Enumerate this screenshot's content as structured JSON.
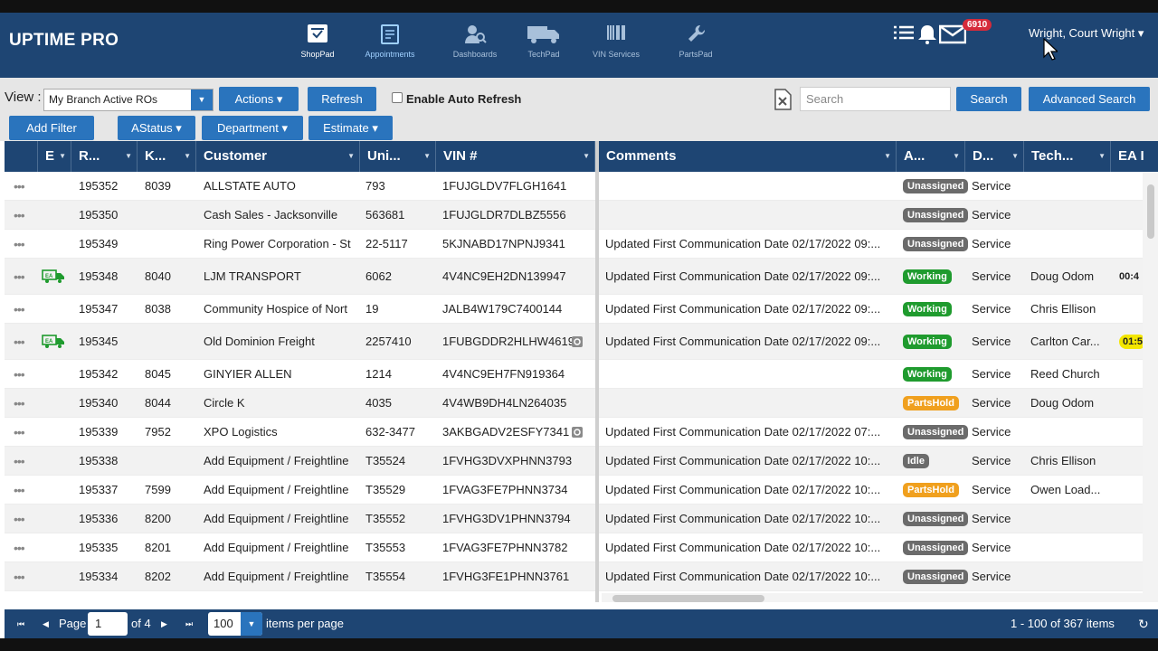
{
  "app": {
    "title": "UPTIME PRO"
  },
  "nav": [
    {
      "label": "ShopPad",
      "icon": "shoppad-icon"
    },
    {
      "label": "Appointments",
      "icon": "appointments-icon"
    },
    {
      "label": "Dashboards",
      "icon": "dashboards-icon"
    },
    {
      "label": "TechPad",
      "icon": "techpad-truck-icon"
    },
    {
      "label": "VIN Services",
      "icon": "barcode-icon"
    },
    {
      "label": "PartsPad",
      "icon": "wrench-icon"
    }
  ],
  "header": {
    "mail_badge": "6910",
    "user": "Wright, Court Wright ▾"
  },
  "toolbar": {
    "view_label": "View :",
    "view_value": "My Branch Active ROs",
    "actions_label": "Actions ▾",
    "refresh_label": "Refresh",
    "auto_refresh_label": "Enable Auto Refresh",
    "search_placeholder": "Search",
    "search_label": "Search",
    "advanced_search_label": "Advanced Search"
  },
  "filters": {
    "add_filter": "Add Filter",
    "astatus": "AStatus ▾",
    "department": "Department ▾",
    "estimate": "Estimate ▾"
  },
  "columns": [
    "E",
    "R...",
    "K...",
    "Customer",
    "Uni...",
    "VIN #",
    "Comments",
    "A...",
    "D...",
    "Tech...",
    "EA I"
  ],
  "status_colors": {
    "Unassigned": "#6b6b6b",
    "Working": "#1f9b2e",
    "PartsHold": "#f0a01e",
    "Idle": "#6b6b6b"
  },
  "rows": [
    {
      "ro": "195352",
      "k": "8039",
      "customer": "ALLSTATE AUTO",
      "unit": "793",
      "vin": "1FUJGLDV7FLGH1641",
      "comments": "",
      "status": "Unassigned",
      "dept": "Service",
      "tech": "",
      "ea": "",
      "icon": false,
      "vinicon": false,
      "ea_style": ""
    },
    {
      "ro": "195350",
      "k": "",
      "customer": "Cash Sales - Jacksonville",
      "unit": "563681",
      "vin": "1FUJGLDR7DLBZ5556",
      "comments": "",
      "status": "Unassigned",
      "dept": "Service",
      "tech": "",
      "ea": "",
      "icon": false,
      "vinicon": false,
      "ea_style": ""
    },
    {
      "ro": "195349",
      "k": "",
      "customer": "Ring Power Corporation - St",
      "unit": "22-5117",
      "vin": "5KJNABD17NPNJ9341",
      "comments": "Updated First Communication Date 02/17/2022 09:...",
      "status": "Unassigned",
      "dept": "Service",
      "tech": "",
      "ea": "",
      "icon": false,
      "vinicon": false,
      "ea_style": ""
    },
    {
      "ro": "195348",
      "k": "8040",
      "customer": "LJM TRANSPORT",
      "unit": "6062",
      "vin": "4V4NC9EH2DN139947",
      "comments": "Updated First Communication Date 02/17/2022 09:...",
      "status": "Working",
      "dept": "Service",
      "tech": "Doug Odom",
      "ea": "00:4",
      "icon": true,
      "vinicon": false,
      "ea_style": "plain"
    },
    {
      "ro": "195347",
      "k": "8038",
      "customer": "Community Hospice of Nort",
      "unit": "19",
      "vin": "JALB4W179C7400144",
      "comments": "Updated First Communication Date 02/17/2022 09:...",
      "status": "Working",
      "dept": "Service",
      "tech": "Chris Ellison",
      "ea": "",
      "icon": false,
      "vinicon": false,
      "ea_style": ""
    },
    {
      "ro": "195345",
      "k": "",
      "customer": "Old Dominion Freight",
      "unit": "2257410",
      "vin": "1FUBGDDR2HLHW4619",
      "comments": "Updated First Communication Date 02/17/2022 09:...",
      "status": "Working",
      "dept": "Service",
      "tech": "Carlton Car...",
      "ea": "01:5",
      "icon": true,
      "vinicon": true,
      "ea_style": "yellow"
    },
    {
      "ro": "195342",
      "k": "8045",
      "customer": "GINYIER ALLEN",
      "unit": "1214",
      "vin": "4V4NC9EH7FN919364",
      "comments": "",
      "status": "Working",
      "dept": "Service",
      "tech": "Reed Church",
      "ea": "",
      "icon": false,
      "vinicon": false,
      "ea_style": ""
    },
    {
      "ro": "195340",
      "k": "8044",
      "customer": "Circle K",
      "unit": "4035",
      "vin": "4V4WB9DH4LN264035",
      "comments": "",
      "status": "PartsHold",
      "dept": "Service",
      "tech": "Doug Odom",
      "ea": "",
      "icon": false,
      "vinicon": false,
      "ea_style": ""
    },
    {
      "ro": "195339",
      "k": "7952",
      "customer": "XPO Logistics",
      "unit": "632-3477",
      "vin": "3AKBGADV2ESFY7341",
      "comments": "Updated First Communication Date 02/17/2022 07:...",
      "status": "Unassigned",
      "dept": "Service",
      "tech": "",
      "ea": "",
      "icon": false,
      "vinicon": true,
      "ea_style": ""
    },
    {
      "ro": "195338",
      "k": "",
      "customer": "Add Equipment / Freightline",
      "unit": "T35524",
      "vin": "1FVHG3DVXPHNN3793",
      "comments": "Updated First Communication Date 02/17/2022 10:...",
      "status": "Idle",
      "dept": "Service",
      "tech": "Chris Ellison",
      "ea": "",
      "icon": false,
      "vinicon": false,
      "ea_style": ""
    },
    {
      "ro": "195337",
      "k": "7599",
      "customer": "Add Equipment / Freightline",
      "unit": "T35529",
      "vin": "1FVAG3FE7PHNN3734",
      "comments": "Updated First Communication Date 02/17/2022 10:...",
      "status": "PartsHold",
      "dept": "Service",
      "tech": "Owen Load...",
      "ea": "",
      "icon": false,
      "vinicon": false,
      "ea_style": ""
    },
    {
      "ro": "195336",
      "k": "8200",
      "customer": "Add Equipment / Freightline",
      "unit": "T35552",
      "vin": "1FVHG3DV1PHNN3794",
      "comments": "Updated First Communication Date 02/17/2022 10:...",
      "status": "Unassigned",
      "dept": "Service",
      "tech": "",
      "ea": "",
      "icon": false,
      "vinicon": false,
      "ea_style": ""
    },
    {
      "ro": "195335",
      "k": "8201",
      "customer": "Add Equipment / Freightline",
      "unit": "T35553",
      "vin": "1FVAG3FE7PHNN3782",
      "comments": "Updated First Communication Date 02/17/2022 10:...",
      "status": "Unassigned",
      "dept": "Service",
      "tech": "",
      "ea": "",
      "icon": false,
      "vinicon": false,
      "ea_style": ""
    },
    {
      "ro": "195334",
      "k": "8202",
      "customer": "Add Equipment / Freightline",
      "unit": "T35554",
      "vin": "1FVHG3FE1PHNN3761",
      "comments": "Updated First Communication Date 02/17/2022 10:...",
      "status": "Unassigned",
      "dept": "Service",
      "tech": "",
      "ea": "",
      "icon": false,
      "vinicon": false,
      "ea_style": ""
    }
  ],
  "footer": {
    "page_label": "Page",
    "page_value": "1",
    "of_label": "of 4",
    "per_page_value": "100",
    "per_page_label": "items per page",
    "summary": "1 - 100 of 367 items"
  }
}
